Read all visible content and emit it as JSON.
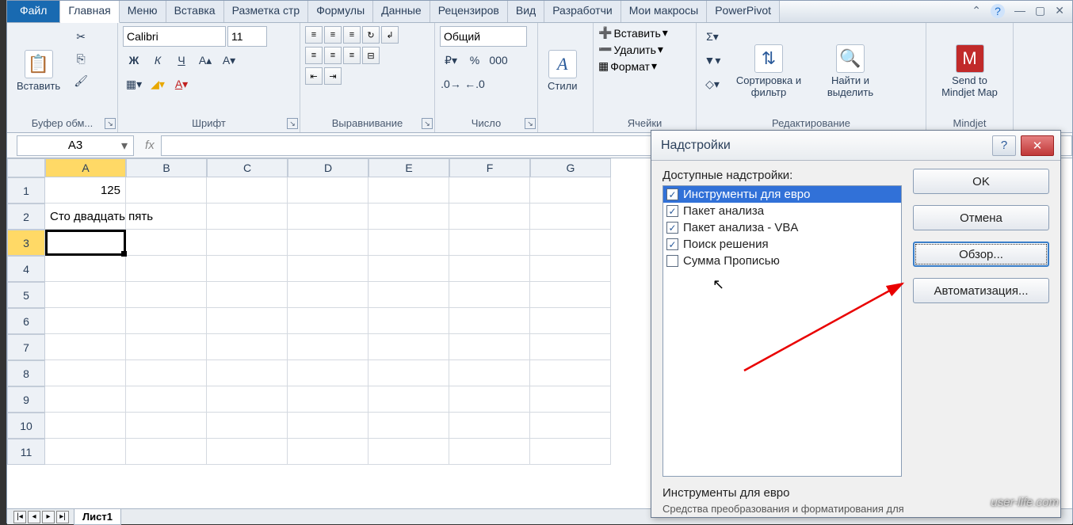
{
  "tabs": {
    "file": "Файл",
    "items": [
      "Главная",
      "Меню",
      "Вставка",
      "Разметка стр",
      "Формулы",
      "Данные",
      "Рецензиров",
      "Вид",
      "Разработчи",
      "Мои макросы",
      "PowerPivot"
    ]
  },
  "ribbon": {
    "clipboard": {
      "label": "Буфер обм...",
      "paste": "Вставить"
    },
    "font": {
      "label": "Шрифт",
      "name": "Calibri",
      "size": "11",
      "bold": "Ж",
      "italic": "К",
      "underline": "Ч"
    },
    "alignment": {
      "label": "Выравнивание"
    },
    "number": {
      "label": "Число",
      "format": "Общий"
    },
    "styles": {
      "label": "Стили"
    },
    "cells": {
      "label": "Ячейки",
      "insert": "Вставить",
      "delete": "Удалить",
      "format": "Формат"
    },
    "editing": {
      "label": "Редактирование",
      "sort": "Сортировка и фильтр",
      "find": "Найти и выделить"
    },
    "mindjet": {
      "label": "Mindjet",
      "send": "Send to Mindjet Map"
    }
  },
  "formula": {
    "name_box": "A3",
    "fx": "fx",
    "value": ""
  },
  "grid": {
    "cols": [
      "A",
      "B",
      "C",
      "D",
      "E",
      "F",
      "G"
    ],
    "rows": [
      "1",
      "2",
      "3",
      "4",
      "5",
      "6",
      "7",
      "8",
      "9",
      "10",
      "11"
    ],
    "a1": "125",
    "a2": "Сто двадцать пять"
  },
  "sheet": {
    "tab": "Лист1"
  },
  "dialog": {
    "title": "Надстройки",
    "available": "Доступные надстройки:",
    "items": [
      {
        "label": "Инструменты для евро",
        "checked": true,
        "selected": true
      },
      {
        "label": "Пакет анализа",
        "checked": true
      },
      {
        "label": "Пакет анализа - VBA",
        "checked": true
      },
      {
        "label": "Поиск решения",
        "checked": true
      },
      {
        "label": "Сумма Прописью",
        "checked": false
      }
    ],
    "ok": "OK",
    "cancel": "Отмена",
    "browse": "Обзор...",
    "automation": "Автоматизация...",
    "footer_title": "Инструменты для евро",
    "footer_desc": "Средства преобразования и форматирования для"
  },
  "watermark": "user-life.com"
}
